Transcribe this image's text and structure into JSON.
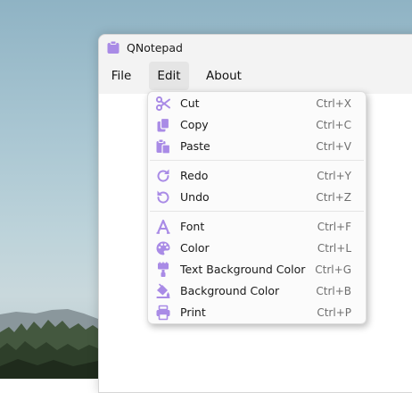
{
  "window": {
    "title": "QNotepad",
    "app_icon": "clipboard-icon",
    "accent_color": "#a98be6"
  },
  "menubar": {
    "items": [
      {
        "label": "File"
      },
      {
        "label": "Edit",
        "active": true
      },
      {
        "label": "About"
      }
    ]
  },
  "edit_menu": {
    "items": [
      {
        "label": "Cut",
        "shortcut": "Ctrl+X",
        "icon": "scissors-icon"
      },
      {
        "label": "Copy",
        "shortcut": "Ctrl+C",
        "icon": "copy-icon"
      },
      {
        "label": "Paste",
        "shortcut": "Ctrl+V",
        "icon": "paste-icon"
      },
      {
        "label": "Redo",
        "shortcut": "Ctrl+Y",
        "icon": "redo-icon"
      },
      {
        "label": "Undo",
        "shortcut": "Ctrl+Z",
        "icon": "undo-icon"
      },
      {
        "label": "Font",
        "shortcut": "Ctrl+F",
        "icon": "font-icon"
      },
      {
        "label": "Color",
        "shortcut": "Ctrl+L",
        "icon": "palette-icon"
      },
      {
        "label": "Text Background Color",
        "shortcut": "Ctrl+G",
        "icon": "paint-roller-icon"
      },
      {
        "label": "Background Color",
        "shortcut": "Ctrl+B",
        "icon": "paint-bucket-icon"
      },
      {
        "label": "Print",
        "shortcut": "Ctrl+P",
        "icon": "printer-icon"
      }
    ]
  }
}
